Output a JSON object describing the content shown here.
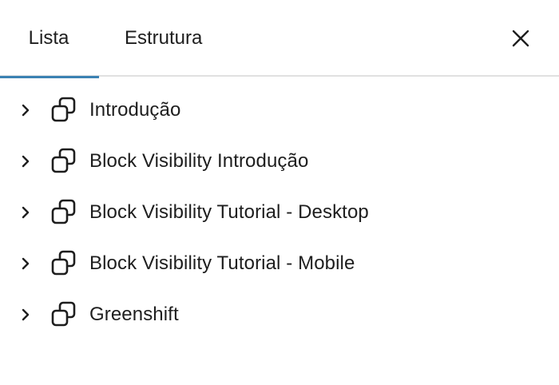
{
  "tabs": {
    "list_label": "Lista",
    "structure_label": "Estrutura"
  },
  "close_icon": "close-icon",
  "colors": {
    "active_tab_indicator": "#3b82b3",
    "text": "#1e1e1e",
    "divider": "#e0e0e0"
  },
  "list": {
    "items": [
      {
        "label": "Introdução",
        "icon": "group-block-icon"
      },
      {
        "label": "Block Visibility Introdução",
        "icon": "group-block-icon"
      },
      {
        "label": "Block Visibility Tutorial - Desktop",
        "icon": "group-block-icon"
      },
      {
        "label": "Block Visibility Tutorial - Mobile",
        "icon": "group-block-icon"
      },
      {
        "label": "Greenshift",
        "icon": "group-block-icon"
      }
    ]
  }
}
